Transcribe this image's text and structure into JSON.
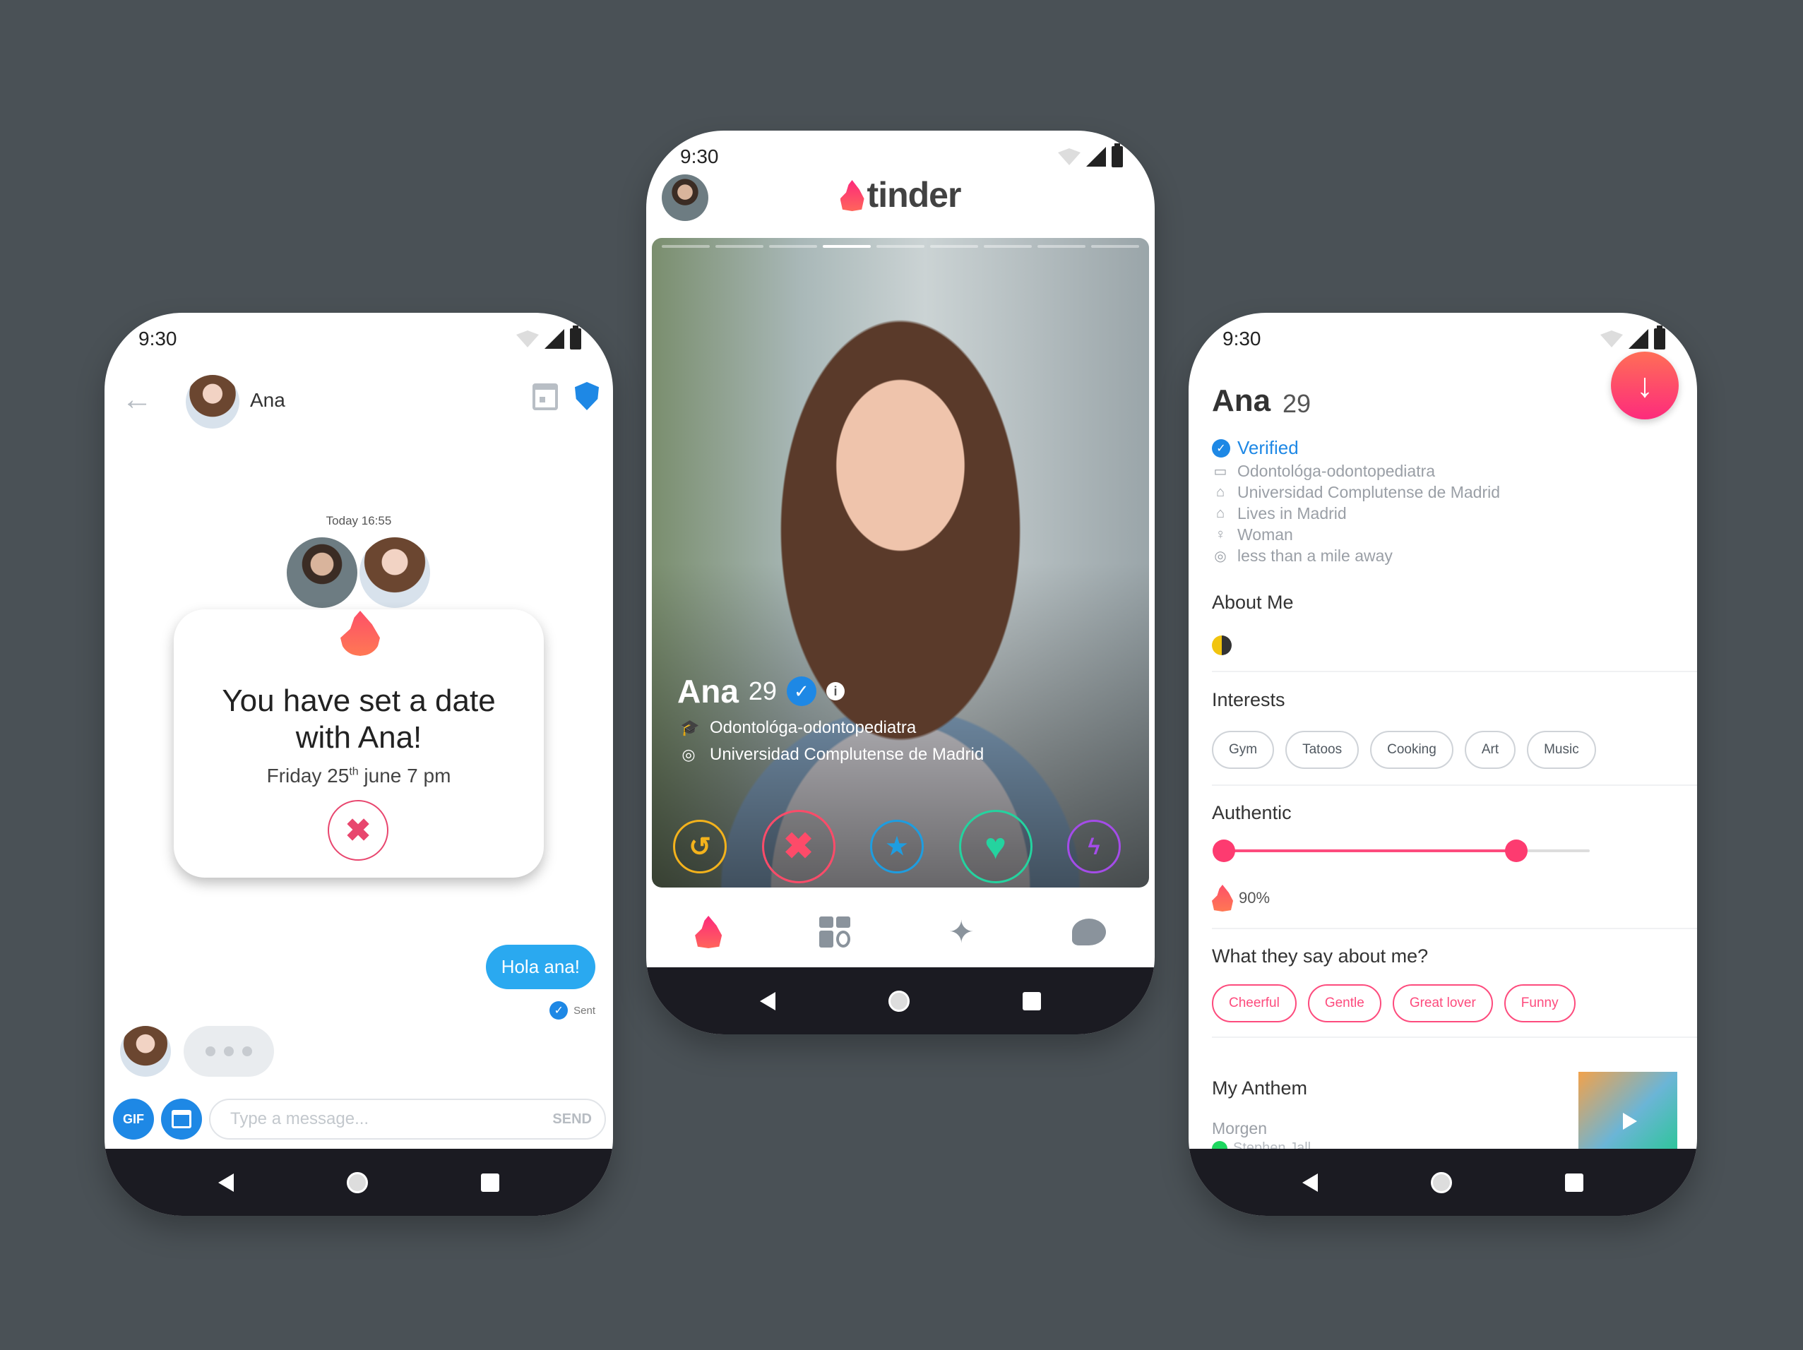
{
  "status": {
    "time": "9:30"
  },
  "chat": {
    "name": "Ana",
    "today": "Today 16:55",
    "card": {
      "title": "You have set a date with Ana!",
      "date_prefix": "Friday 25",
      "date_sup": "th",
      "date_suffix": " june 7 pm",
      "cancel_icon": "✖"
    },
    "sent_message": "Hola ana!",
    "sent_status": "Sent",
    "composer": {
      "gif_label": "GIF",
      "placeholder": "Type a message...",
      "send_label": "SEND"
    }
  },
  "swipe": {
    "logo_text": "tinder",
    "photo_count": 9,
    "active_photo_index": 3,
    "name": "Ana",
    "age": "29",
    "job": "Odontológa-odontopediatra",
    "school": "Universidad Complutense de Madrid",
    "actions": {
      "rewind": "↺",
      "nope": "✖",
      "super": "★",
      "like": "♥",
      "boost": "ϟ"
    },
    "tabs": {
      "explore": "✦"
    }
  },
  "profile": {
    "name": "Ana",
    "age": "29",
    "verified_label": "Verified",
    "facts": {
      "job": "Odontológa-odontopediatra",
      "school": "Universidad Complutense de Madrid",
      "location": "Lives in Madrid",
      "gender": "Woman",
      "distance": "less than a mile away"
    },
    "about_title": "About Me",
    "interests_title": "Interests",
    "interests": [
      "Gym",
      "Tatoos",
      "Cooking",
      "Art",
      "Music"
    ],
    "authentic_title": "Authentic",
    "authentic_slider_fraction": 0.8,
    "authentic_percent": "90%",
    "say_title": "What they say about me?",
    "say_tags": [
      "Cheerful",
      "Gentle",
      "Great lover",
      "Funny"
    ],
    "anthem_title": "My Anthem",
    "anthem_song": "Morgen",
    "anthem_artist": "Stephen Jall"
  },
  "colors": {
    "background": "#4a5156",
    "brand_pink": "#fd4b7d",
    "blue": "#1e88e5",
    "rewind": "#f3b21c",
    "like": "#24d39f",
    "boost": "#a44ce8"
  },
  "icons": {
    "back": "arrow-left-icon",
    "calendar": "calendar-icon",
    "shield": "shield-icon",
    "job": "briefcase-icon",
    "school": "graduation-cap-icon",
    "home": "home-icon",
    "gender": "person-icon",
    "distance": "location-pin-icon"
  }
}
